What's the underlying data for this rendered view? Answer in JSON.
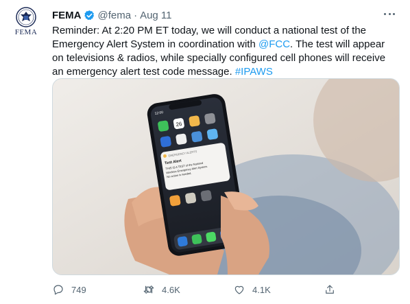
{
  "author": {
    "name": "FEMA",
    "handle": "@fema",
    "separator": "·",
    "date": "Aug 11",
    "avatar_text": "FEMA",
    "verified": true
  },
  "tweet": {
    "text_1": "Reminder: At 2:20 PM ET today, we will conduct a national test of the Emergency Alert System in coordination with ",
    "mention": "@FCC",
    "text_2": ". The test will appear on televisions & radios, while specially configured cell phones will receive an emergency alert test code message. ",
    "hashtag": "#IPAWS"
  },
  "image": {
    "status_time": "12:00",
    "calendar_day": "26",
    "alert_header": "EMERGENCY ALERTS",
    "alert_title": "Test Alert",
    "alert_body": [
      "THIS IS A TEST of the National",
      "Wireless Emergency Alert System.",
      "No action is needed."
    ]
  },
  "actions": {
    "replies": "749",
    "retweets": "4.6K",
    "likes": "4.1K"
  },
  "colors": {
    "link": "#1d9bf0",
    "secondary_text": "#536471",
    "border": "#cfd9de",
    "verified": "#1d9bf0"
  }
}
